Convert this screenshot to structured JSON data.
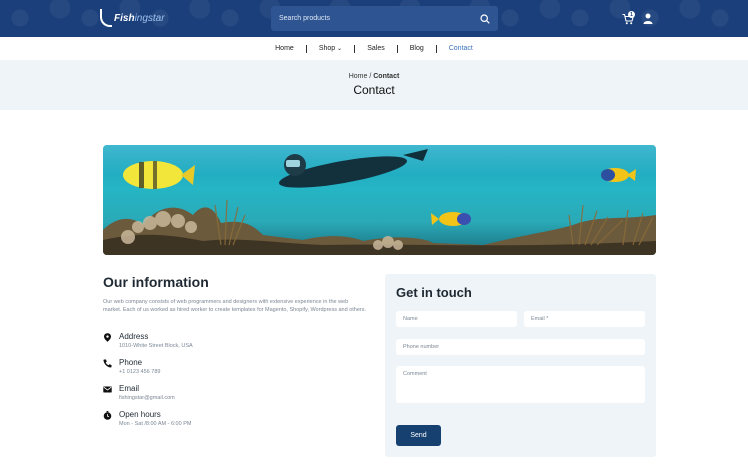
{
  "header": {
    "logo_main": "Fish",
    "logo_sub": "ingstar",
    "search_placeholder": "Search products",
    "cart_count": "1"
  },
  "nav": {
    "items": [
      {
        "label": "Home"
      },
      {
        "label": "Shop"
      },
      {
        "label": "Sales"
      },
      {
        "label": "Blog"
      },
      {
        "label": "Contact"
      }
    ]
  },
  "breadcrumb": {
    "home": "Home",
    "sep": "/",
    "current": "Contact",
    "title": "Contact"
  },
  "info": {
    "title": "Our information",
    "description": "Our web company consists of web programmers and designers with extensive experience in the web market. Each of us worked as hired worker to create templates for Magento, Shopify, Wordpress and others.",
    "items": [
      {
        "label": "Address",
        "value": "1010-White Street Block, USA",
        "icon": "location-pin-icon"
      },
      {
        "label": "Phone",
        "value": "+1 0123 456 789",
        "icon": "phone-icon"
      },
      {
        "label": "Email",
        "value": "fishingstar@gmail.com",
        "icon": "mail-icon"
      },
      {
        "label": "Open hours",
        "value": "Mon - Sat /8:00 AM - 6:00 PM",
        "icon": "clock-icon"
      }
    ]
  },
  "form": {
    "title": "Get in touch",
    "name_placeholder": "Name",
    "email_placeholder": "Email *",
    "phone_placeholder": "Phone number",
    "comment_placeholder": "Comment",
    "send_label": "Send"
  },
  "colors": {
    "header": "#1b3f7a",
    "accent": "#3b73b9",
    "button": "#16406f",
    "panel": "#eef4f7"
  }
}
